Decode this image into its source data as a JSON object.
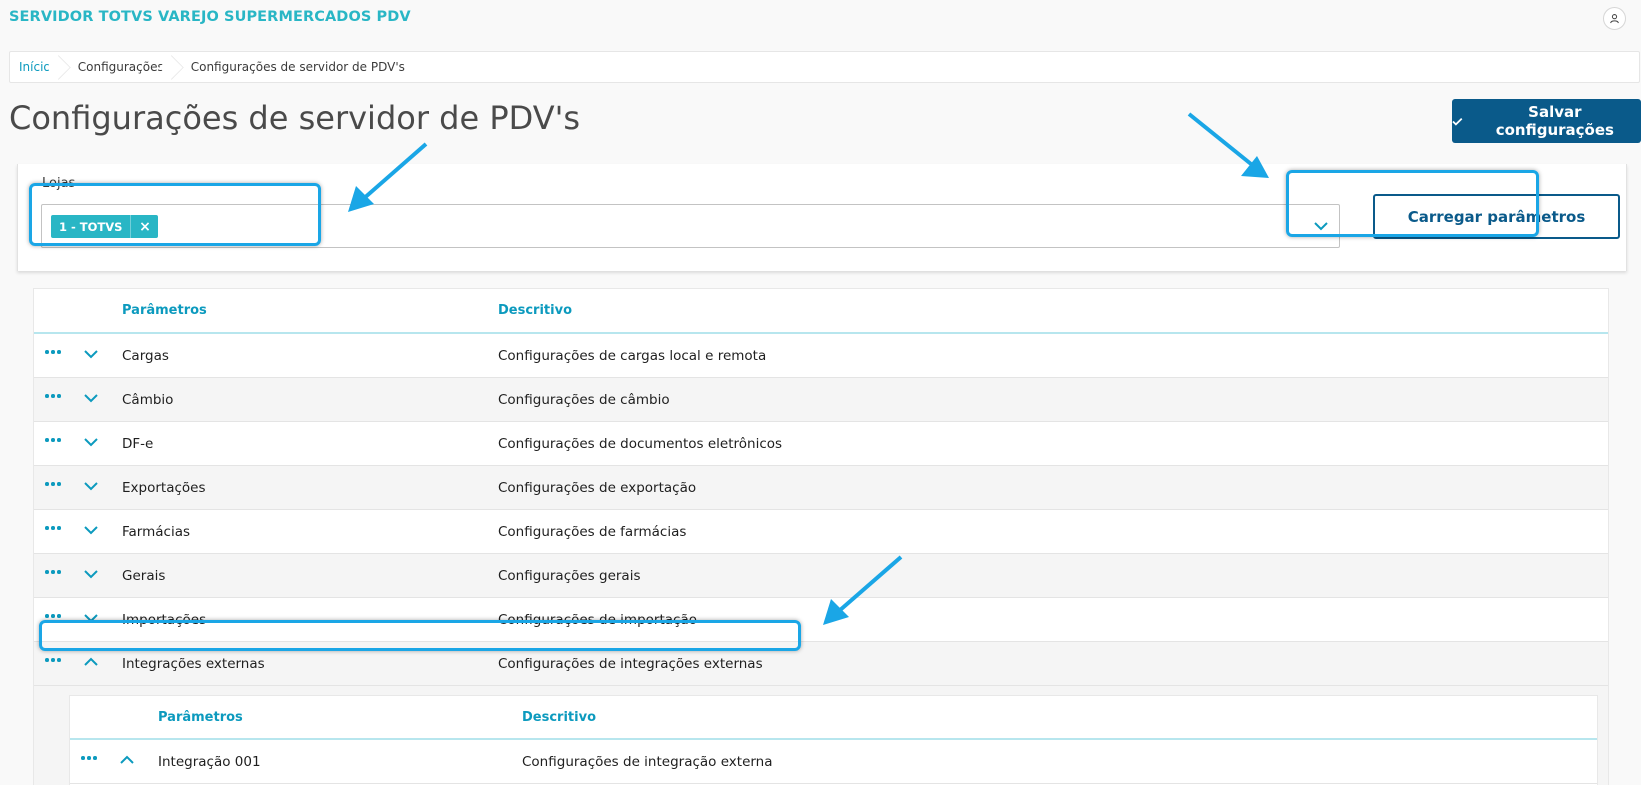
{
  "app": {
    "title": "SERVIDOR TOTVS VAREJO SUPERMERCADOS PDV"
  },
  "breadcrumb": [
    "Início",
    "Configurações",
    "Configurações de servidor de PDV's"
  ],
  "page": {
    "title": "Configurações de servidor de PDV's",
    "save_label": "Salvar configurações"
  },
  "filter": {
    "label": "Lojas",
    "selected_tag": "1 - TOTVS",
    "load_label": "Carregar parâmetros"
  },
  "table": {
    "headers": {
      "param": "Parâmetros",
      "desc": "Descritivo"
    },
    "rows": [
      {
        "param": "Cargas",
        "desc": "Configurações de cargas local e remota",
        "expanded": false
      },
      {
        "param": "Câmbio",
        "desc": "Configurações de câmbio",
        "expanded": false
      },
      {
        "param": "DF-e",
        "desc": "Configurações de documentos eletrônicos",
        "expanded": false
      },
      {
        "param": "Exportações",
        "desc": "Configurações de exportação",
        "expanded": false
      },
      {
        "param": "Farmácias",
        "desc": "Configurações de farmácias",
        "expanded": false
      },
      {
        "param": "Gerais",
        "desc": "Configurações gerais",
        "expanded": false
      },
      {
        "param": "Importações",
        "desc": "Configurações de importação",
        "expanded": false
      },
      {
        "param": "Integrações externas",
        "desc": "Configurações de integrações externas",
        "expanded": true
      }
    ],
    "subtable": {
      "headers": {
        "param": "Parâmetros",
        "desc": "Descritivo"
      },
      "rows": [
        {
          "param": "Integração 001",
          "desc": "Configurações de integração externa",
          "expanded": true
        }
      ]
    }
  },
  "colors": {
    "brand": "#29b6c5",
    "primary": "#0a5a8a",
    "link": "#0c9abe",
    "annotation": "#1aa6e6"
  }
}
